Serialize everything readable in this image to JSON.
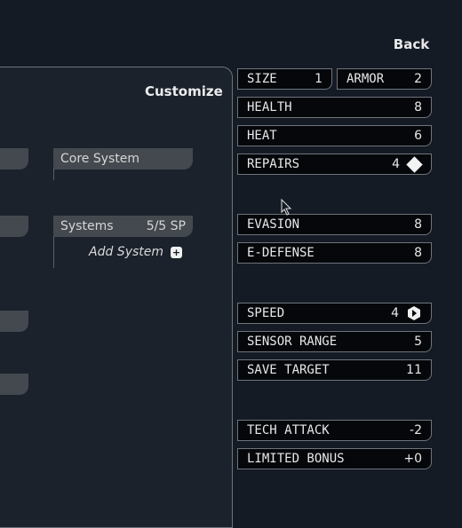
{
  "header": {
    "back_label": "Back"
  },
  "panel": {
    "title": "Customize",
    "core_system_label": "Core System",
    "systems_label": "Systems",
    "systems_sp": "5/5 SP",
    "add_system_label": "Add System"
  },
  "stats": {
    "size": {
      "label": "SIZE",
      "value": "1"
    },
    "armor": {
      "label": "ARMOR",
      "value": "2"
    },
    "health": {
      "label": "HEALTH",
      "value": "8"
    },
    "heat": {
      "label": "HEAT",
      "value": "6"
    },
    "repairs": {
      "label": "REPAIRS",
      "value": "4"
    },
    "evasion": {
      "label": "EVASION",
      "value": "8"
    },
    "edefense": {
      "label": "E-DEFENSE",
      "value": "8"
    },
    "speed": {
      "label": "SPEED",
      "value": "4"
    },
    "sensor_range": {
      "label": "SENSOR RANGE",
      "value": "5"
    },
    "save_target": {
      "label": "SAVE TARGET",
      "value": "11"
    },
    "tech_attack": {
      "label": "TECH ATTACK",
      "value": "-2"
    },
    "limited_bonus": {
      "label": "LIMITED BONUS",
      "value": "+0"
    }
  },
  "icons": {
    "repairs": "diamond-icon",
    "speed": "hex-arrow-icon",
    "add": "plus-hex-icon"
  }
}
